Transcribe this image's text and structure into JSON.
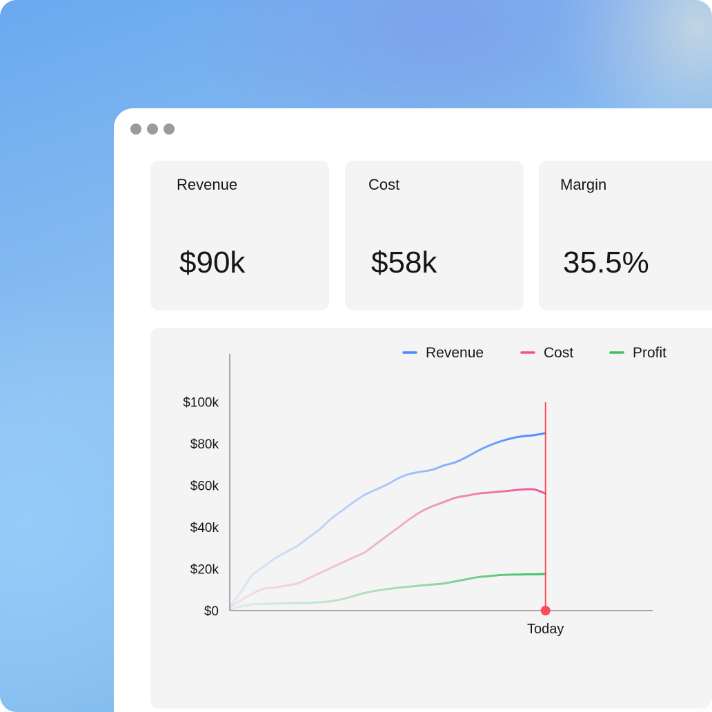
{
  "window": {
    "controls": [
      "dot-icon",
      "dot-icon",
      "dot-icon"
    ]
  },
  "cards": [
    {
      "label": "Revenue",
      "value": "$90k"
    },
    {
      "label": "Cost",
      "value": "$58k"
    },
    {
      "label": "Margin",
      "value": "35.5%"
    }
  ],
  "chart_data": {
    "type": "line",
    "title": "",
    "xlabel": "",
    "ylabel": "",
    "x_tick_labels": [
      {
        "x": 28,
        "label": "Today"
      }
    ],
    "today_marker": {
      "x": 28,
      "label": "Today",
      "color": "#fa4d56"
    },
    "y_ticks": [
      0,
      20000,
      40000,
      60000,
      80000,
      100000
    ],
    "y_tick_labels": [
      "$0",
      "$20k",
      "$40k",
      "$60k",
      "$80k",
      "$100k"
    ],
    "ylim": [
      0,
      110000
    ],
    "xlim": [
      0,
      37.5
    ],
    "grid": false,
    "legend_position": "top-right",
    "x": [
      0,
      1,
      2,
      3,
      4,
      5,
      6,
      7,
      8,
      9,
      10,
      11,
      12,
      13,
      14,
      15,
      16,
      17,
      18,
      19,
      20,
      21,
      22,
      23,
      24,
      25,
      26,
      27,
      28
    ],
    "series": [
      {
        "name": "Revenue",
        "color": "#4589ff",
        "values": [
          2000,
          9000,
          17000,
          21000,
          25000,
          28000,
          31000,
          35000,
          39000,
          44000,
          48000,
          52000,
          55500,
          58000,
          60500,
          63500,
          65500,
          66500,
          67500,
          69500,
          71000,
          73500,
          76500,
          79000,
          81000,
          82500,
          83500,
          84000,
          85000
        ]
      },
      {
        "name": "Cost",
        "color": "#ee5396",
        "values": [
          1500,
          5000,
          8000,
          10500,
          11000,
          12000,
          13000,
          15500,
          18000,
          20500,
          23000,
          25500,
          28000,
          32000,
          36000,
          40000,
          44000,
          47500,
          50000,
          52000,
          54000,
          55000,
          56000,
          56500,
          57000,
          57500,
          58000,
          58000,
          56000
        ]
      },
      {
        "name": "Profit",
        "color": "#42be65",
        "values": [
          500,
          2000,
          3000,
          3200,
          3400,
          3500,
          3600,
          3700,
          4000,
          4500,
          5500,
          7000,
          8500,
          9500,
          10300,
          11000,
          11500,
          12000,
          12500,
          13000,
          14000,
          15000,
          16000,
          16500,
          17000,
          17200,
          17300,
          17400,
          17500
        ]
      }
    ]
  }
}
